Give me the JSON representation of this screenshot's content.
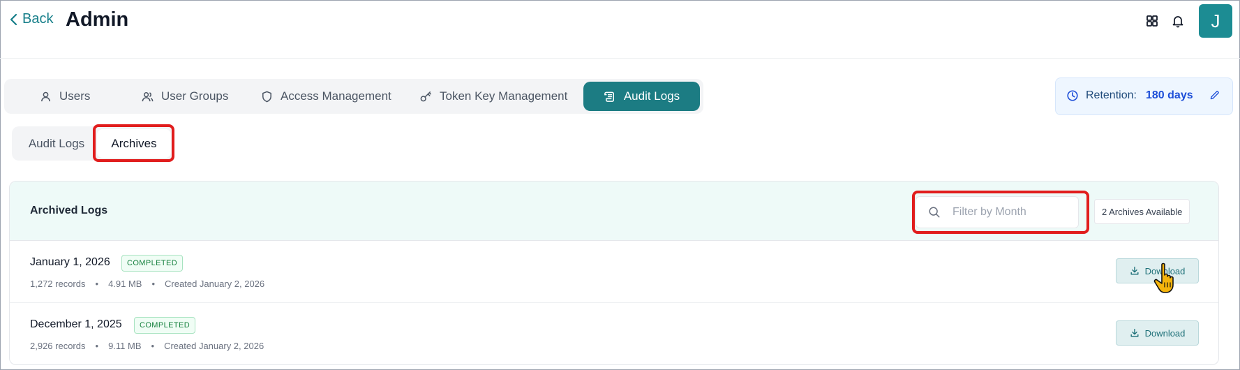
{
  "header": {
    "back_label": "Back",
    "title": "Admin",
    "icons": [
      "grid-icon",
      "bell-icon"
    ],
    "avatar_initial": "J",
    "avatar_color": "#1c8c93"
  },
  "main_tabs": [
    {
      "label": "Users",
      "icon": "user-icon"
    },
    {
      "label": "User Groups",
      "icon": "users-icon"
    },
    {
      "label": "Access Management",
      "icon": "shield-icon"
    },
    {
      "label": "Token Key Management",
      "icon": "key-icon"
    },
    {
      "label": "Audit Logs",
      "icon": "scroll-icon",
      "active": true
    }
  ],
  "retention": {
    "label": "Retention:",
    "value": "180 days"
  },
  "sub_tabs": [
    {
      "label": "Audit Logs"
    },
    {
      "label": "Archives",
      "active": true
    }
  ],
  "archives": {
    "title": "Archived Logs",
    "search_placeholder": "Filter by Month",
    "count_label": "2 Archives Available",
    "rows": [
      {
        "month": "January 1, 2026",
        "status": "COMPLETED",
        "records": "1,272 records",
        "size": "4.91 MB",
        "created": "Created January 2, 2026",
        "action": "Download"
      },
      {
        "month": "December 1, 2025",
        "status": "COMPLETED",
        "records": "2,926 records",
        "size": "9.11 MB",
        "created": "Created January 2, 2026",
        "action": "Download"
      }
    ]
  },
  "colors": {
    "accent": "#1c7c83",
    "highlight": "#e11d1d",
    "status_green": "#15803d"
  }
}
